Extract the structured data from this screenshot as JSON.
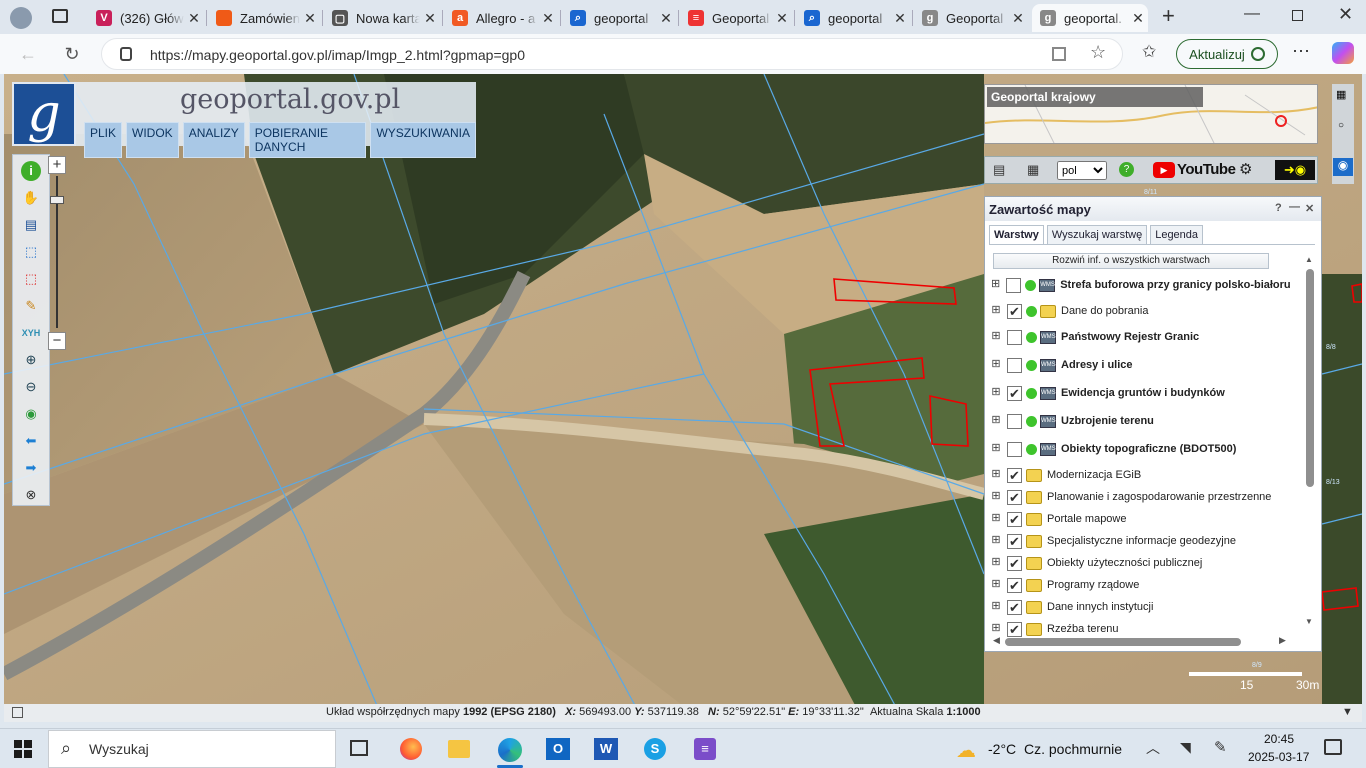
{
  "tabs": [
    {
      "title": "(326) Głów",
      "fav": "#c9205a",
      "glyph": "V",
      "active": false
    },
    {
      "title": "Zamówienia",
      "fav": "#f05a17",
      "glyph": "",
      "active": false
    },
    {
      "title": "Nowa karta",
      "fav": "#555",
      "glyph": "▢",
      "active": false
    },
    {
      "title": "Allegro - a",
      "fav": "#f15a24",
      "glyph": "a",
      "active": false
    },
    {
      "title": "geoportal",
      "fav": "#1a66d0",
      "glyph": "⌕",
      "active": false
    },
    {
      "title": "Geoportal",
      "fav": "#e33",
      "glyph": "≡",
      "active": false
    },
    {
      "title": "geoportal",
      "fav": "#1a66d0",
      "glyph": "⌕",
      "active": false
    },
    {
      "title": "Geoportal",
      "fav": "#888",
      "glyph": "g",
      "active": false
    },
    {
      "title": "geoportal.",
      "fav": "#888",
      "glyph": "g",
      "active": true
    }
  ],
  "address": {
    "url": "https://mapy.geoportal.gov.pl/imap/Imgp_2.html?gpmap=gp0",
    "update_label": "Aktualizuj"
  },
  "geoportal": {
    "title": "geoportal.gov.pl",
    "menu": [
      "PLIK",
      "WIDOK",
      "ANALIZY",
      "POBIERANIE DANYCH",
      "WYSZUKIWANIA"
    ],
    "minimap_label": "Geoportal krajowy",
    "lang": "pol",
    "youtube": "YouTube"
  },
  "panel": {
    "title": "Zawartość mapy",
    "tabs": [
      "Warstwy",
      "Wyszukaj warstwę",
      "Legenda"
    ],
    "expand_all": "Rozwiń inf. o wszystkich warstwach",
    "layers": [
      {
        "label": "Strefa buforowa przy granicy polsko-białoruskiej",
        "checked": false,
        "bold": true,
        "type": "service",
        "active_dot": true
      },
      {
        "label": "Dane do pobrania",
        "checked": true,
        "bold": false,
        "type": "folder",
        "active_dot": true
      },
      {
        "label": "Państwowy Rejestr Granic",
        "checked": false,
        "bold": true,
        "type": "service",
        "active_dot": true
      },
      {
        "label": "Adresy i ulice",
        "checked": false,
        "bold": true,
        "type": "service",
        "active_dot": true
      },
      {
        "label": "Ewidencja gruntów i budynków",
        "checked": true,
        "bold": true,
        "type": "service",
        "active_dot": true
      },
      {
        "label": "Uzbrojenie terenu",
        "checked": false,
        "bold": true,
        "type": "service",
        "active_dot": true
      },
      {
        "label": "Obiekty topograficzne (BDOT500)",
        "checked": false,
        "bold": true,
        "type": "service",
        "active_dot": true
      },
      {
        "label": "Modernizacja EGiB",
        "checked": true,
        "bold": false,
        "type": "folder",
        "active_dot": false
      },
      {
        "label": "Planowanie i zagospodarowanie przestrzenne",
        "checked": true,
        "bold": false,
        "type": "folder",
        "active_dot": false
      },
      {
        "label": "Portale mapowe",
        "checked": true,
        "bold": false,
        "type": "folder",
        "active_dot": false
      },
      {
        "label": "Specjalistyczne informacje geodezyjne",
        "checked": true,
        "bold": false,
        "type": "folder",
        "active_dot": false
      },
      {
        "label": "Obiekty użyteczności publicznej",
        "checked": true,
        "bold": false,
        "type": "folder",
        "active_dot": false
      },
      {
        "label": "Programy rządowe",
        "checked": true,
        "bold": false,
        "type": "folder",
        "active_dot": false
      },
      {
        "label": "Dane innych instytucji",
        "checked": true,
        "bold": false,
        "type": "folder",
        "active_dot": false
      },
      {
        "label": "Rzeźba terenu",
        "checked": true,
        "bold": false,
        "type": "folder",
        "active_dot": false
      }
    ]
  },
  "scalebar": {
    "mid": "15",
    "end": "30m"
  },
  "status": {
    "crs_prefix": "Układ współrzędnych mapy",
    "crs": "1992 (EPSG 2180)",
    "x_label": "X:",
    "x": "569493.00",
    "y_label": "Y:",
    "y": "537119.38",
    "n_label": "N:",
    "n": "52°59'22.51\"",
    "e_label": "E:",
    "e": "19°33'11.32\"",
    "scale_label": "Aktualna Skala",
    "scale": "1:1000"
  },
  "map_labels": [
    "8/11",
    "8/13",
    "8/8",
    "8/9"
  ],
  "taskbar": {
    "search": "Wyszukaj",
    "weather": "-2°C",
    "weather_desc": "Cz. pochmurnie",
    "time": "20:45",
    "date": "2025-03-17"
  }
}
